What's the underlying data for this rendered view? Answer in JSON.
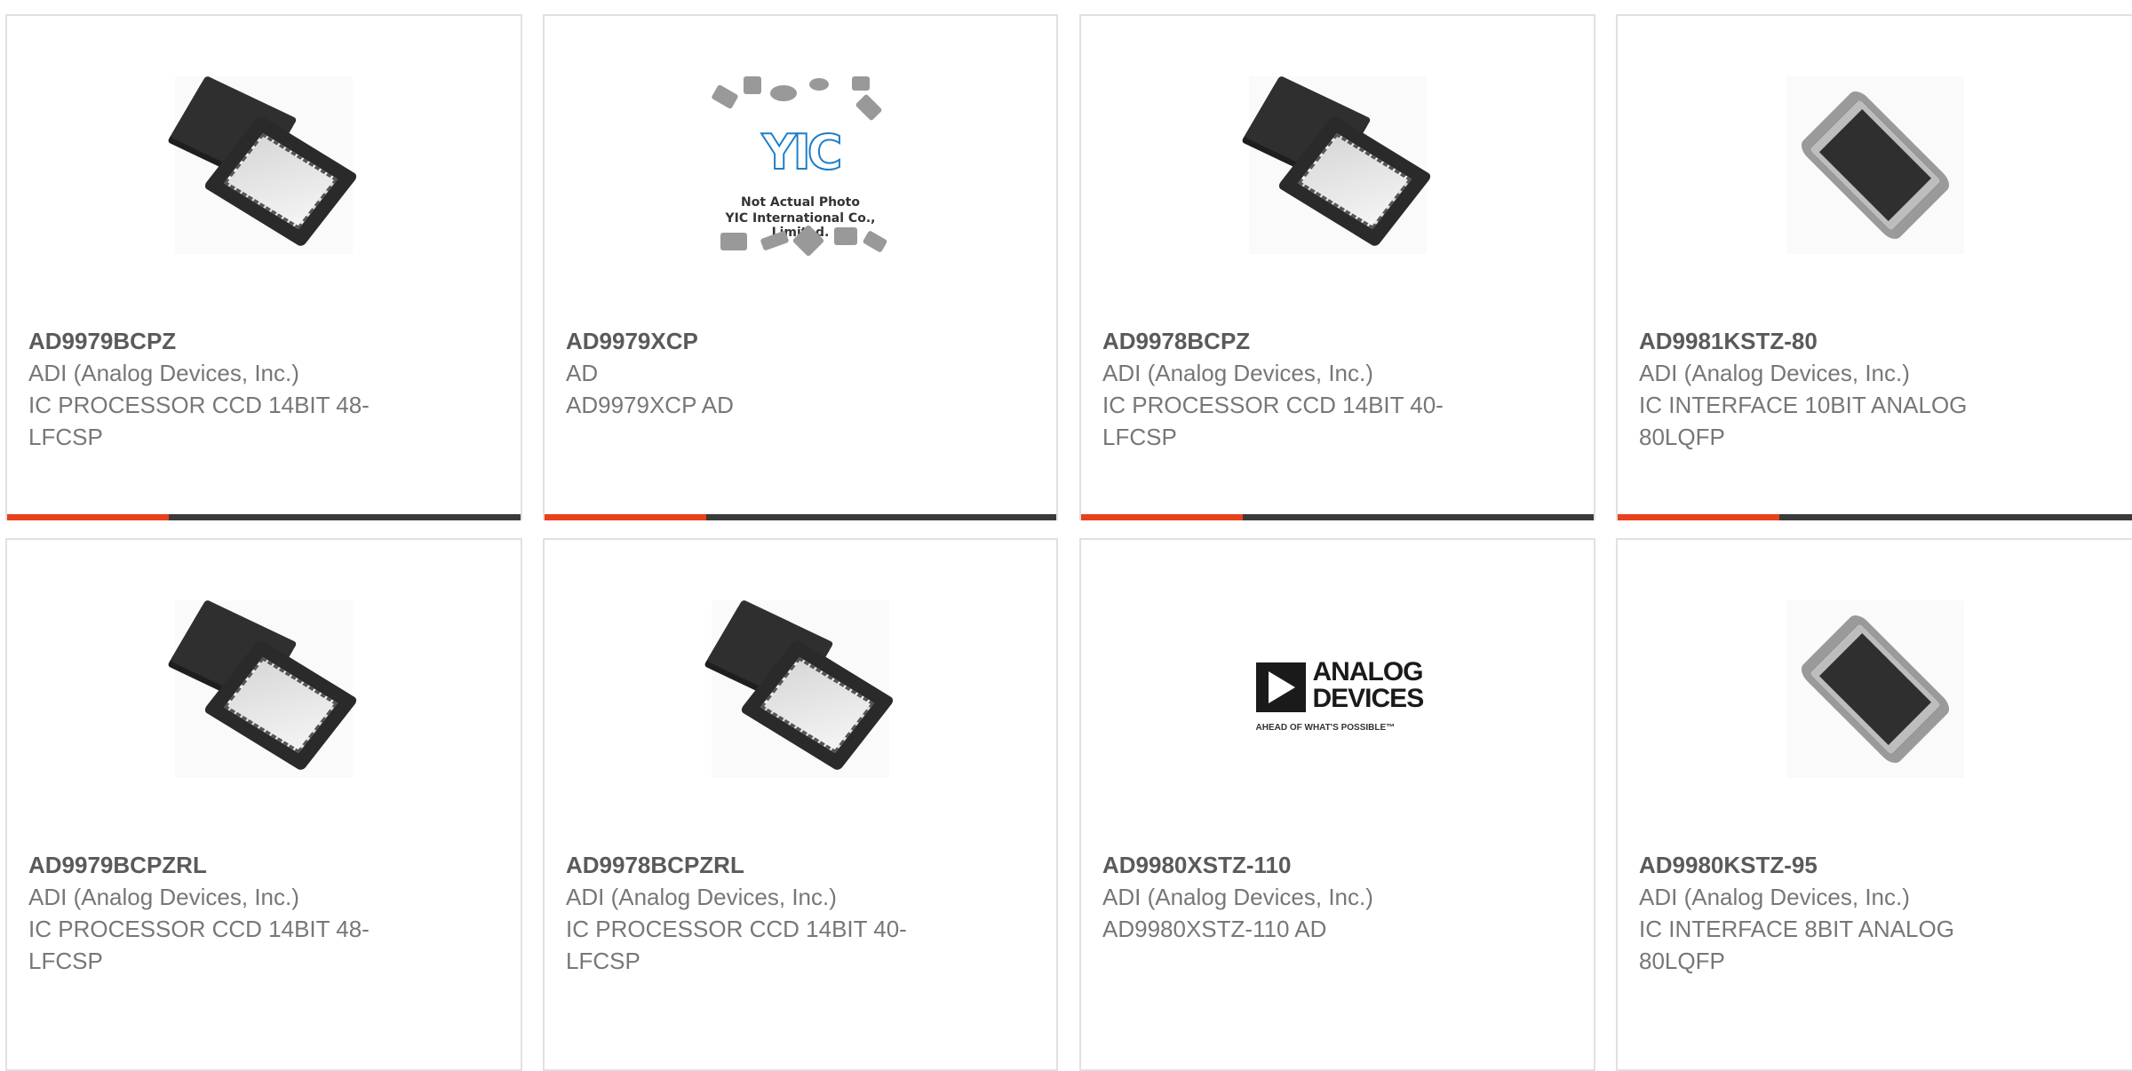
{
  "products": [
    {
      "part_number": "AD9979BCPZ",
      "manufacturer": "ADI (Analog Devices, Inc.)",
      "description": "IC PROCESSOR CCD 14BIT 48-LFCSP",
      "image": "chip-open-lfcsp-icon"
    },
    {
      "part_number": "AD9979XCP",
      "manufacturer": "AD",
      "description": "AD9979XCP AD",
      "image": "not-actual-photo-icon",
      "image_text": [
        "YIC",
        "Not Actual Photo",
        "YIC International Co., Limited."
      ]
    },
    {
      "part_number": "AD9978BCPZ",
      "manufacturer": "ADI (Analog Devices, Inc.)",
      "description": "IC PROCESSOR CCD 14BIT 40-LFCSP",
      "image": "chip-open-lfcsp-icon"
    },
    {
      "part_number": "AD9981KSTZ-80",
      "manufacturer": "ADI (Analog Devices, Inc.)",
      "description": "IC INTERFACE 10BIT ANALOG 80LQFP",
      "image": "chip-lqfp-icon"
    },
    {
      "part_number": "AD9979BCPZRL",
      "manufacturer": "ADI (Analog Devices, Inc.)",
      "description": "IC PROCESSOR CCD 14BIT 48-LFCSP",
      "image": "chip-open-lfcsp-icon"
    },
    {
      "part_number": "AD9978BCPZRL",
      "manufacturer": "ADI (Analog Devices, Inc.)",
      "description": "IC PROCESSOR CCD 14BIT 40-LFCSP",
      "image": "chip-open-lfcsp-icon"
    },
    {
      "part_number": "AD9980XSTZ-110",
      "manufacturer": "ADI (Analog Devices, Inc.)",
      "description": "AD9980XSTZ-110 AD",
      "image": "analog-devices-logo",
      "image_text": [
        "ANALOG",
        "DEVICES",
        "AHEAD OF WHAT'S POSSIBLE™"
      ]
    },
    {
      "part_number": "AD9980KSTZ-95",
      "manufacturer": "ADI (Analog Devices, Inc.)",
      "description": "IC INTERFACE 8BIT ANALOG 80LQFP",
      "image": "chip-lqfp-icon"
    }
  ],
  "colors": {
    "accent": "#e8411c",
    "bar": "#3a3a3a",
    "part_number": "#5a5a5a",
    "text": "#777777",
    "border": "#e1e1e1"
  }
}
